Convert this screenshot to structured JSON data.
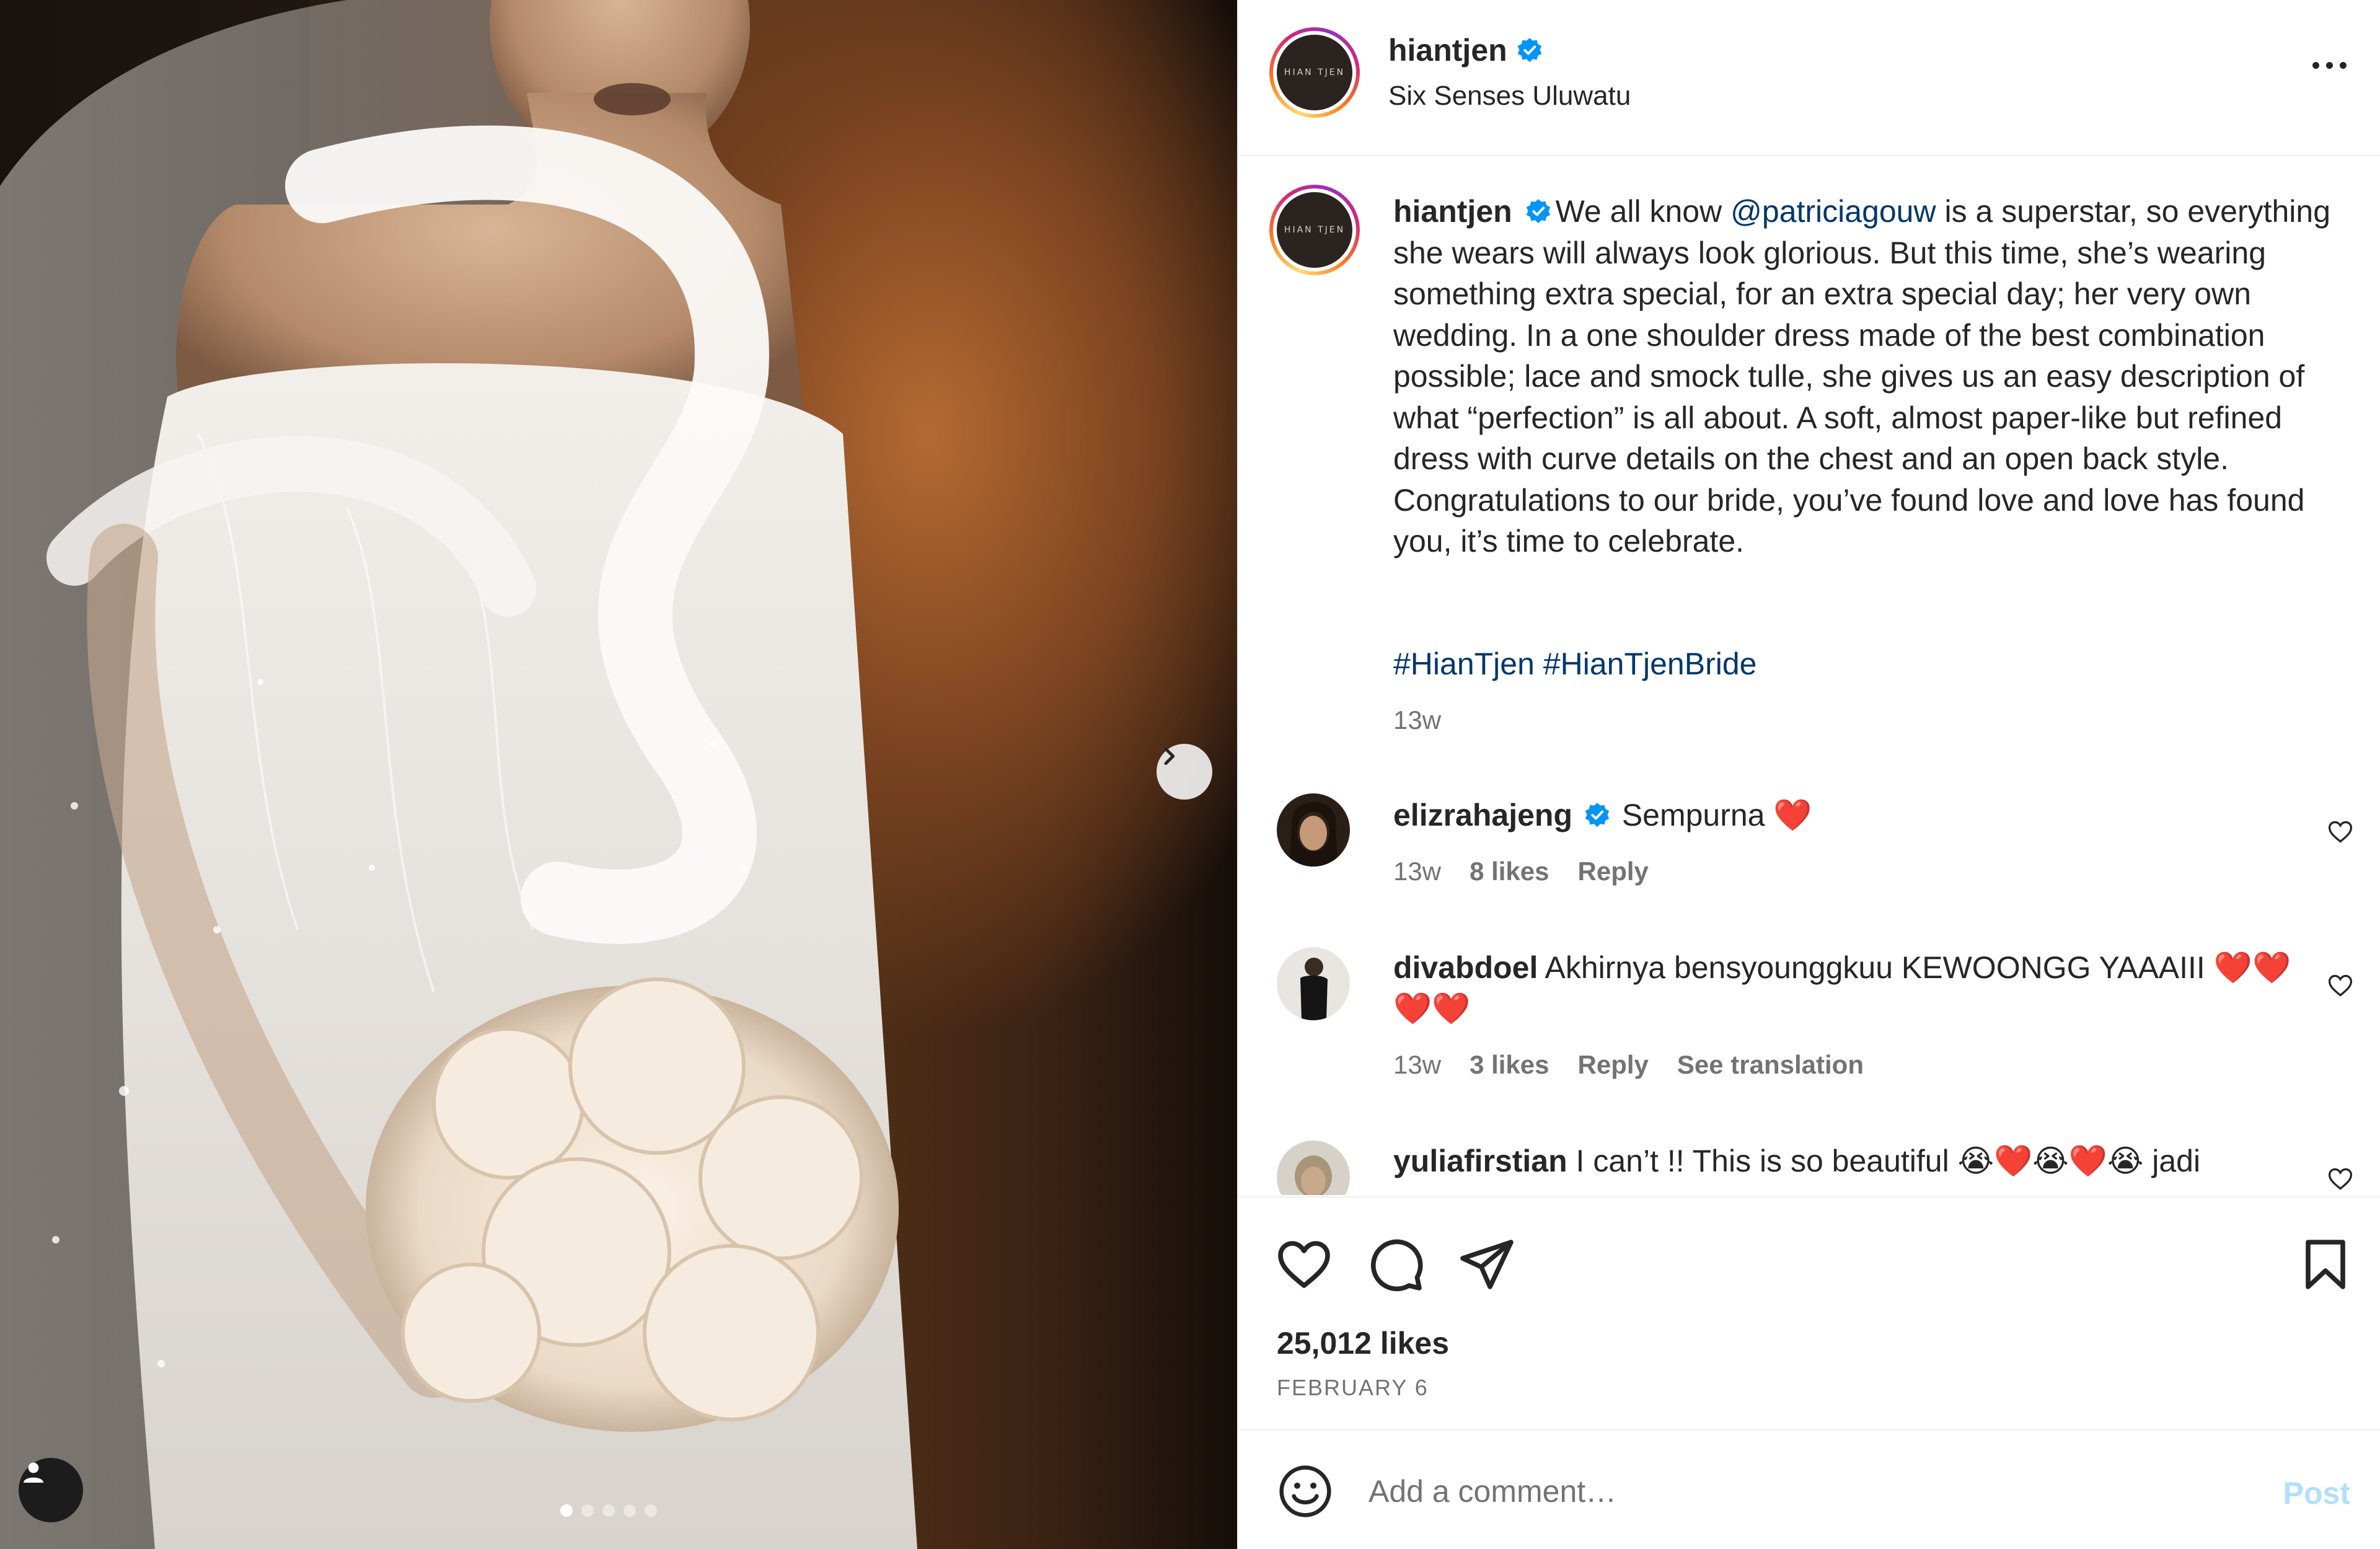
{
  "post": {
    "username": "hiantjen",
    "location": "Six Senses Uluwatu",
    "avatar_text": "HIAN TJEN",
    "carousel": {
      "slide_count": 5,
      "active_index": 0
    }
  },
  "caption": {
    "username": "hiantjen",
    "text_before_mention": "We all know ",
    "mention": "@patriciagouw",
    "text_after_mention": " is a superstar, so everything she wears will always look glorious. But this time, she’s wearing something extra special, for an extra special day; her very own wedding. In a one shoulder dress made of the best combination possible; lace and smock tulle, she gives us an easy description of what “perfection” is all about. A soft, almost paper-like but refined dress with curve details on the chest and an open back style. Congratulations to our bride, you’ve found love and love has found you, it’s time to celebrate.",
    "hashtags": [
      "#HianTjen",
      "#HianTjenBride"
    ],
    "time": "13w"
  },
  "comments": [
    {
      "username": "elizrahajeng",
      "verified": true,
      "text": "Sempurna ❤️",
      "time": "13w",
      "likes": "8 likes",
      "reply": "Reply",
      "translate": ""
    },
    {
      "username": "divabdoel",
      "verified": false,
      "text": "Akhirnya bensyounggkuu KEWOONGG YAAAIII ❤️❤️❤️❤️",
      "time": "13w",
      "likes": "3 likes",
      "reply": "Reply",
      "translate": "See translation"
    },
    {
      "username": "yuliafirstian",
      "verified": false,
      "text": "I can’t !! This is so beautiful 😭❤️😭❤️😭 jadi",
      "time": "",
      "likes": "",
      "reply": "",
      "translate": ""
    }
  ],
  "engagement": {
    "likes": "25,012 likes",
    "date": "FEBRUARY 6"
  },
  "composer": {
    "placeholder": "Add a comment…",
    "post_label": "Post"
  },
  "colors": {
    "link": "#00376b",
    "muted": "#737373",
    "post_disabled": "#b2dffc",
    "verified": "#0095f6"
  },
  "icons": [
    "chevron-right-icon",
    "user-tag-icon",
    "more-icon",
    "verified-icon",
    "heart-icon",
    "comment-icon",
    "share-icon",
    "bookmark-icon",
    "emoji-icon"
  ]
}
